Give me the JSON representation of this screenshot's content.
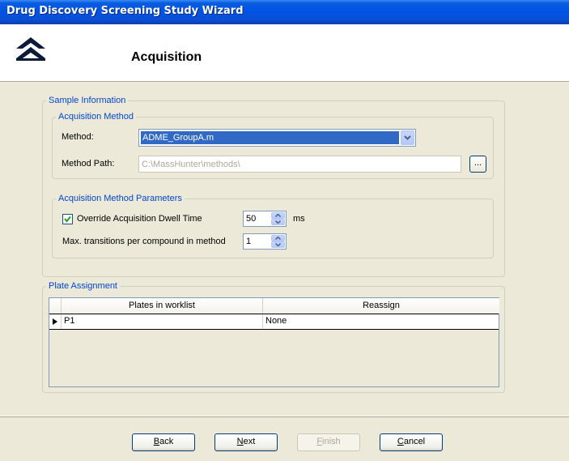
{
  "window": {
    "title": "Drug Discovery Screening Study Wizard"
  },
  "header": {
    "title": "Acquisition",
    "logo_icon": "chevron-up-logo-icon"
  },
  "sample_information": {
    "legend": "Sample Information",
    "acquisition_method": {
      "legend": "Acquisition Method",
      "method_label": "Method:",
      "method_value": "ADME_GroupA.m",
      "method_path_label": "Method Path:",
      "method_path_value": "C:\\MassHunter\\methods\\",
      "browse_label": "..."
    },
    "parameters": {
      "legend": "Acquisition Method Parameters",
      "override_label": "Override Acquisition Dwell Time",
      "override_checked": true,
      "dwell_value": "50",
      "dwell_unit": "ms",
      "max_transitions_label": "Max. transitions per compound in method",
      "max_transitions_value": "1"
    }
  },
  "plate_assignment": {
    "legend": "Plate Assignment",
    "columns": [
      "Plates in worklist",
      "Reassign"
    ],
    "rows": [
      {
        "plate": "P1",
        "reassign": "None"
      }
    ]
  },
  "footer": {
    "back_first": "B",
    "back_rest": "ack",
    "next_first": "N",
    "next_rest": "ext",
    "finish_first": "F",
    "finish_rest": "inish",
    "cancel_first": "C",
    "cancel_rest": "ancel"
  },
  "colors": {
    "titlebar": "#0054e3",
    "legend": "#0046d5",
    "selection": "#316ac5",
    "dialog_bg": "#ece9d8"
  }
}
